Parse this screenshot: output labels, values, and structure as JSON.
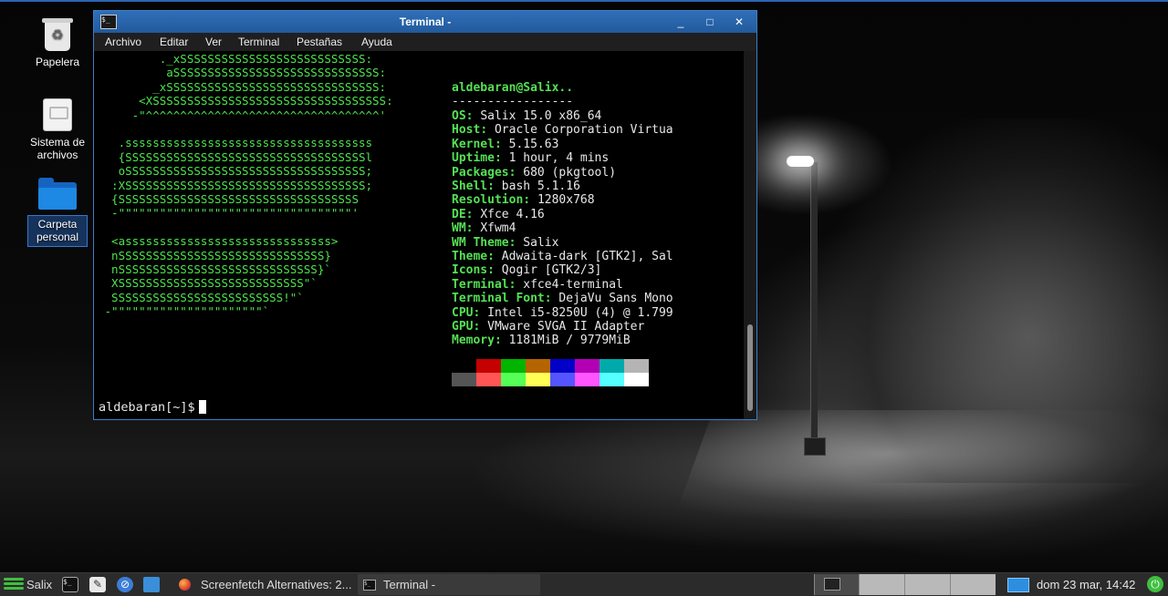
{
  "desktop": {
    "icons": [
      {
        "label": "Papelera",
        "name": "trash"
      },
      {
        "label": "Sistema de archivos",
        "name": "filesystem"
      },
      {
        "label": "Carpeta personal",
        "name": "home-folder"
      }
    ]
  },
  "terminal": {
    "title": "Terminal -",
    "app_icon_text": "$_",
    "buttons": {
      "minimize": "_",
      "maximize": "□",
      "close": "✕"
    },
    "menu": [
      "Archivo",
      "Editar",
      "Ver",
      "Terminal",
      "Pestañas",
      "Ayuda"
    ],
    "ascii_logo": [
      "         ._xSSSSSSSSSSSSSSSSSSSSSSSSSSS:",
      "          aSSSSSSSSSSSSSSSSSSSSSSSSSSSSSS:",
      "        _xSSSSSSSSSSSSSSSSSSSSSSSSSSSSSSS:",
      "      <XSSSSSSSSSSSSSSSSSSSSSSSSSSSSSSSSSS:",
      "     -\"^^^^^^^^^^^^^^^^^^^^^^^^^^^^^^^^^^'",
      "",
      "   .ssssssssssssssssssssssssssssssssssss",
      "   {SSSSSSSSSSSSSSSSSSSSSSSSSSSSSSSSSSSl",
      "   oSSSSSSSSSSSSSSSSSSSSSSSSSSSSSSSSSSS;",
      "  :XSSSSSSSSSSSSSSSSSSSSSSSSSSSSSSSSSSS;",
      "  {SSSSSSSSSSSSSSSSSSSSSSSSSSSSSSSSSSS",
      "  -\"\"\"\"\"\"\"\"\"\"\"\"\"\"\"\"\"\"\"\"\"\"\"\"\"\"\"\"\"\"\"\"\"\"'",
      "",
      "  <assssssssssssssssssssssssssssss>",
      "  nSSSSSSSSSSSSSSSSSSSSSSSSSSSSSS}",
      "  nSSSSSSSSSSSSSSSSSSSSSSSSSSSSS}`",
      "  XSSSSSSSSSSSSSSSSSSSSSSSSSSS\"`",
      "  SSSSSSSSSSSSSSSSSSSSSSSSS!\"`",
      " -\"\"\"\"\"\"\"\"\"\"\"\"\"\"\"\"\"\"\"\"\"\"`"
    ],
    "user_host": "aldebaran@Salix..",
    "separator": "-----------------",
    "info": [
      {
        "key": "OS",
        "value": "Salix 15.0 x86_64"
      },
      {
        "key": "Host",
        "value": "Oracle Corporation Virtua"
      },
      {
        "key": "Kernel",
        "value": "5.15.63"
      },
      {
        "key": "Uptime",
        "value": "1 hour, 4 mins"
      },
      {
        "key": "Packages",
        "value": "680 (pkgtool)"
      },
      {
        "key": "Shell",
        "value": "bash 5.1.16"
      },
      {
        "key": "Resolution",
        "value": "1280x768"
      },
      {
        "key": "DE",
        "value": "Xfce 4.16"
      },
      {
        "key": "WM",
        "value": "Xfwm4"
      },
      {
        "key": "WM Theme",
        "value": "Salix"
      },
      {
        "key": "Theme",
        "value": "Adwaita-dark [GTK2], Sal"
      },
      {
        "key": "Icons",
        "value": "Qogir [GTK2/3]"
      },
      {
        "key": "Terminal",
        "value": "xfce4-terminal"
      },
      {
        "key": "Terminal Font",
        "value": "DejaVu Sans Mono"
      },
      {
        "key": "CPU",
        "value": "Intel i5-8250U (4) @ 1.799"
      },
      {
        "key": "GPU",
        "value": "VMware SVGA II Adapter"
      },
      {
        "key": "Memory",
        "value": "1181MiB / 9779MiB"
      }
    ],
    "palette_normal": [
      "#000000",
      "#c40000",
      "#00b400",
      "#b46400",
      "#0000c8",
      "#b400b4",
      "#00aaaa",
      "#b4b4b4"
    ],
    "palette_bright": [
      "#555555",
      "#ff5555",
      "#55ff55",
      "#ffff55",
      "#5555ff",
      "#ff55ff",
      "#55ffff",
      "#ffffff"
    ],
    "prompt": "aldebaran[~]$"
  },
  "taskbar": {
    "start_label": "Salix",
    "quicklaunch": [
      "terminal-icon",
      "text-editor-icon",
      "web-browser-icon",
      "file-manager-icon"
    ],
    "tasks": [
      {
        "label": "Screenfetch Alternatives: 2...",
        "icon": "firefox-icon",
        "active": false
      },
      {
        "label": "Terminal -",
        "icon": "terminal-icon",
        "active": true
      }
    ],
    "clock": "dom 23 mar, 14:42",
    "colors": {
      "accent": "#3fbf3f",
      "window_title": "#2f6fb8"
    }
  }
}
